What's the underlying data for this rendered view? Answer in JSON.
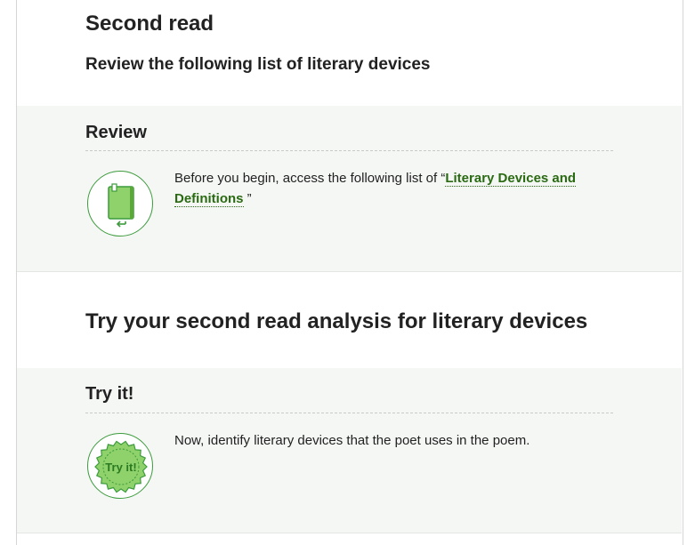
{
  "section": {
    "title": "Second read",
    "subtitle": "Review the following list of literary devices"
  },
  "review": {
    "title": "Review",
    "text_before": "Before you begin, access the following list of “",
    "link_label": "Literary Devices and Definitions",
    "text_after": " ”",
    "icon": "book-icon"
  },
  "analysis": {
    "heading": "Try your second read analysis for literary devices"
  },
  "try_it": {
    "title": "Try it!",
    "badge_text": "Try it!",
    "text": "Now, identify literary devices that the poet uses in the poem.",
    "icon": "try-it-seal-icon"
  },
  "colors": {
    "accent_green": "#3c9b3c",
    "link_green": "#2a6a12",
    "panel_bg": "#f5f7f5"
  }
}
